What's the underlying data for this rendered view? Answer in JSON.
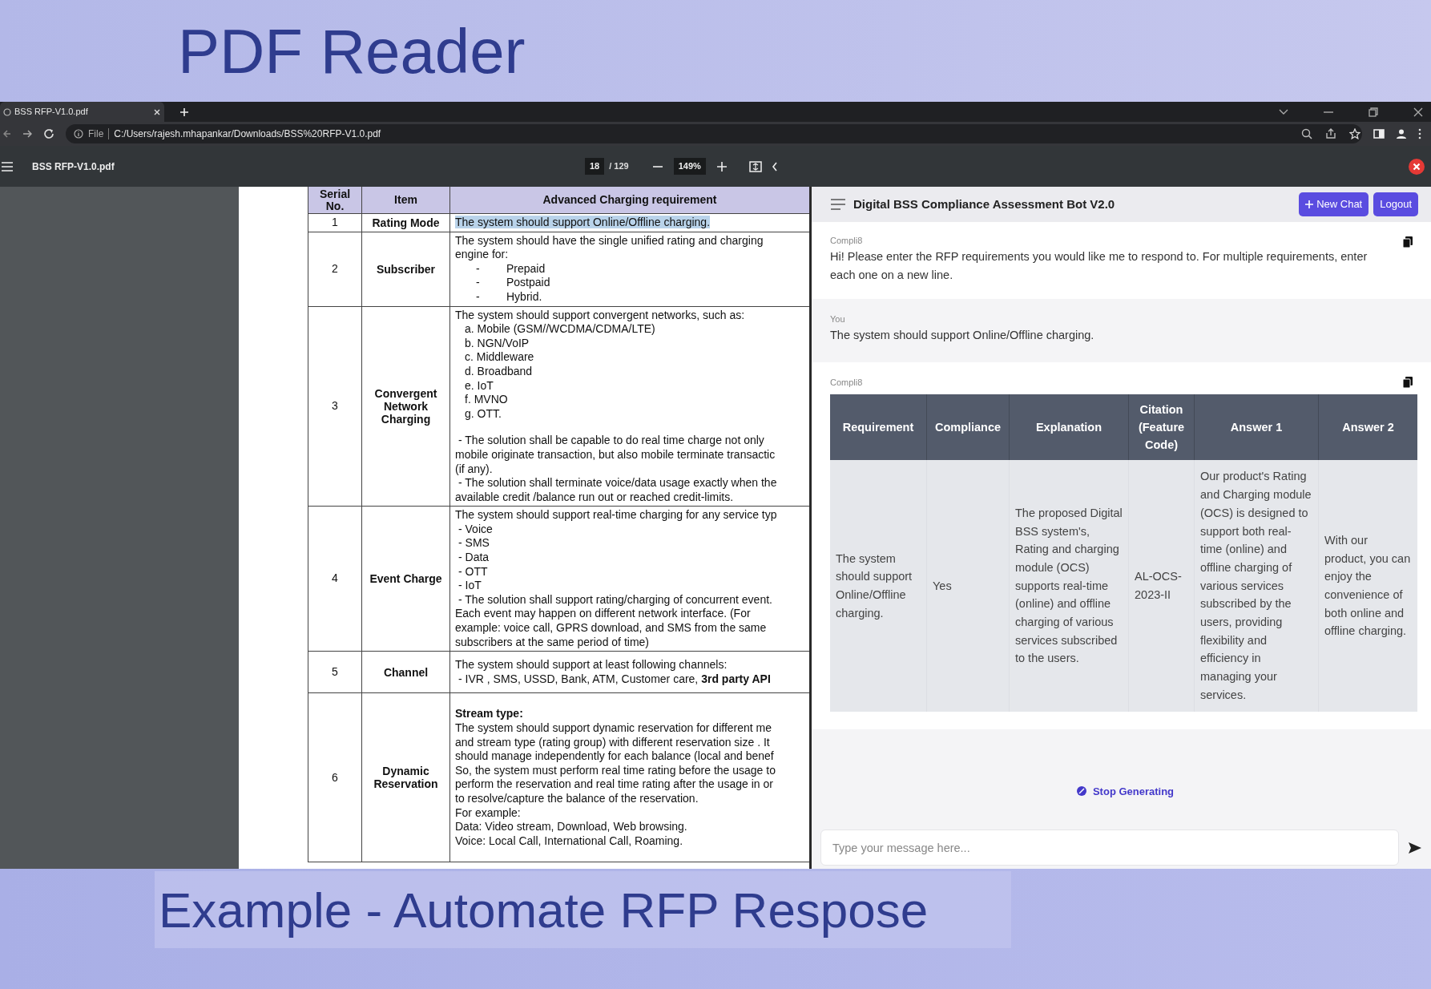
{
  "banner": {
    "title": "PDF Reader"
  },
  "browser": {
    "tab": {
      "title": "BSS RFP-V1.0.pdf"
    },
    "address": {
      "scheme": "File",
      "url": "C:/Users/rajesh.mhapankar/Downloads/BSS%20RFP-V1.0.pdf"
    }
  },
  "pdf_toolbar": {
    "file_name": "BSS RFP-V1.0.pdf",
    "page": "18",
    "page_count": "/ 129",
    "zoom": "149%"
  },
  "pdf_table": {
    "columns": [
      "Serial No.",
      "Item",
      "Advanced Charging requirement"
    ],
    "rows": [
      {
        "serial": "1",
        "item": "Rating Mode",
        "highlighted": true,
        "lines": [
          {
            "kind": "plain",
            "text": "The system should support Online/Offline charging."
          }
        ]
      },
      {
        "serial": "2",
        "item": "Subscriber",
        "highlighted": false,
        "lines": [
          {
            "kind": "plain",
            "text": "The system should have the single unified rating and charging"
          },
          {
            "kind": "plain",
            "text": "engine for:"
          },
          {
            "kind": "sub",
            "marker": "-",
            "text": "Prepaid"
          },
          {
            "kind": "sub",
            "marker": "-",
            "text": "Postpaid"
          },
          {
            "kind": "sub",
            "marker": "-",
            "text": "Hybrid."
          }
        ]
      },
      {
        "serial": "3",
        "item": "Convergent Network Charging",
        "highlighted": false,
        "lines": [
          {
            "kind": "plain",
            "text": "The system should support convergent networks, such as:"
          },
          {
            "kind": "list",
            "text": "a. Mobile (GSM//WCDMA/CDMA/LTE)"
          },
          {
            "kind": "list",
            "text": "b. NGN/VoIP"
          },
          {
            "kind": "list",
            "text": "c. Middleware"
          },
          {
            "kind": "list",
            "text": "d. Broadband"
          },
          {
            "kind": "list",
            "text": "e. IoT"
          },
          {
            "kind": "list",
            "text": "f.  MVNO"
          },
          {
            "kind": "list",
            "text": "g. OTT."
          },
          {
            "kind": "spaced",
            "text": "- The solution shall be capable to do real time charge not only"
          },
          {
            "kind": "plain",
            "text": "mobile originate transaction, but also mobile terminate transactic"
          },
          {
            "kind": "plain",
            "text": "(if any)."
          },
          {
            "kind": "dash",
            "text": "- The solution shall terminate voice/data usage exactly when the"
          },
          {
            "kind": "plain",
            "text": "available credit /balance run out or reached credit-limits."
          }
        ]
      },
      {
        "serial": "4",
        "item": "Event Charge",
        "highlighted": false,
        "lines": [
          {
            "kind": "plain",
            "text": "The system should support real-time charging for any service typ"
          },
          {
            "kind": "dash",
            "text": "- Voice"
          },
          {
            "kind": "dash",
            "text": "- SMS"
          },
          {
            "kind": "dash",
            "text": "- Data"
          },
          {
            "kind": "dash",
            "text": "- OTT"
          },
          {
            "kind": "dash",
            "text": "- IoT"
          },
          {
            "kind": "dash",
            "text": "- The solution shall support rating/charging of concurrent event."
          },
          {
            "kind": "plain",
            "text": "Each event may happen on different network interface. (For"
          },
          {
            "kind": "plain",
            "text": "example: voice call, GPRS download, and SMS from the same"
          },
          {
            "kind": "plain",
            "text": "subscribers at the same period of time)"
          }
        ]
      },
      {
        "serial": "5",
        "item": "Channel",
        "highlighted": false,
        "lines": [
          {
            "kind": "plain",
            "text": "The system should support at least following channels:"
          },
          {
            "kind": "dash",
            "text": "- IVR , SMS, USSD, Bank, ATM, Customer care, **3rd party API**"
          }
        ]
      },
      {
        "serial": "6",
        "item": "Dynamic Reservation",
        "highlighted": false,
        "lines": [
          {
            "kind": "heading",
            "text": "Stream type:"
          },
          {
            "kind": "plain",
            "text": "The system should support dynamic reservation for different me"
          },
          {
            "kind": "plain",
            "text": "and stream type (rating group) with different reservation size . It"
          },
          {
            "kind": "plain",
            "text": "should manage independently for each balance (local and benef"
          },
          {
            "kind": "plain",
            "text": "So, the system must perform real time rating before the usage to"
          },
          {
            "kind": "plain",
            "text": "perform the reservation and real time rating after the usage in or"
          },
          {
            "kind": "plain",
            "text": "to resolve/capture the balance of the reservation."
          },
          {
            "kind": "plain",
            "text": "For example:"
          },
          {
            "kind": "plain",
            "text": "Data: Video stream, Download, Web browsing."
          },
          {
            "kind": "plain",
            "text": "Voice: Local Call, International Call, Roaming."
          }
        ]
      }
    ]
  },
  "chat": {
    "title": "Digital BSS Compliance Assessment Bot V2.0",
    "buttons": [
      {
        "kind": "new",
        "label": "New Chat"
      },
      {
        "kind": "logout",
        "label": "Logout"
      }
    ],
    "messages": [
      {
        "kind": "bot",
        "sender": "Compli8",
        "text": "Hi! Please enter the RFP requirements you would like me to respond to. For multiple requirements, enter each one on a new line."
      },
      {
        "kind": "user",
        "sender": "You",
        "text": "The system should support Online/Offline charging."
      },
      {
        "kind": "bot",
        "sender": "Compli8",
        "table": {
          "columns": [
            "Requirement",
            "Compliance",
            "Explanation",
            "Citation (Feature Code)",
            "Answer 1",
            "Answer 2"
          ],
          "rows": [
            [
              "The system should support Online/Offline charging.",
              "Yes",
              "The proposed Digital BSS system's, Rating and charging module (OCS) supports real-time (online) and offline charging of various services subscribed to the users.",
              "AL-OCS-2023-II",
              "Our product's Rating and Charging module (OCS) is designed to support both real-time (online) and offline charging of various services subscribed by the users, providing flexibility and efficiency in managing your services.",
              "With our product, you can enjoy the convenience of both online and offline charging."
            ]
          ]
        }
      }
    ],
    "stop_label": "Stop Generating",
    "input": {
      "placeholder": "Type your message here..."
    }
  },
  "caption": "Example - Automate RFP Respose"
}
